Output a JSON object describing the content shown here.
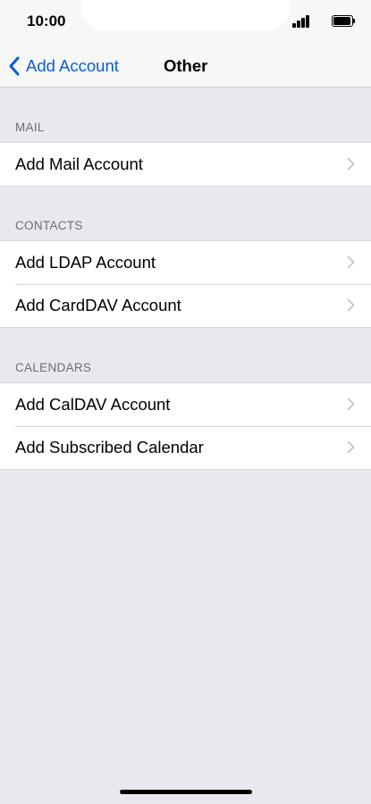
{
  "status_bar": {
    "time": "10:00",
    "signal_icon": "signal-bars-icon",
    "battery_icon": "battery-icon"
  },
  "nav": {
    "back_label": "Add Account",
    "back_icon": "chevron-left-icon",
    "title": "Other"
  },
  "colors": {
    "accent": "#0a5cd6",
    "background": "#e9e8ee",
    "cell": "#ffffff",
    "section_text": "#6d6d72"
  },
  "sections": [
    {
      "header": "MAIL",
      "items": [
        {
          "label": "Add Mail Account"
        }
      ]
    },
    {
      "header": "CONTACTS",
      "items": [
        {
          "label": "Add LDAP Account"
        },
        {
          "label": "Add CardDAV Account"
        }
      ]
    },
    {
      "header": "CALENDARS",
      "items": [
        {
          "label": "Add CalDAV Account"
        },
        {
          "label": "Add Subscribed Calendar"
        }
      ]
    }
  ]
}
